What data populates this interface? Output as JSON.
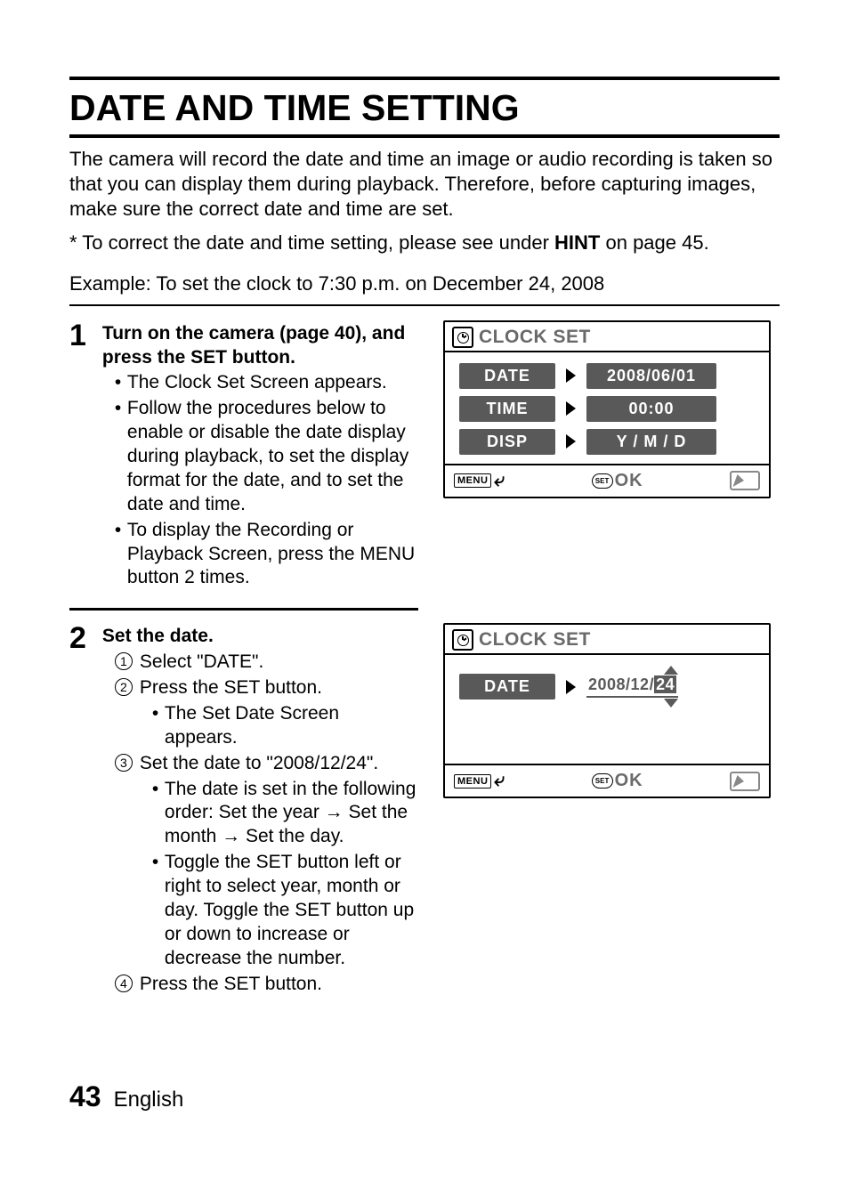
{
  "title": "DATE AND TIME SETTING",
  "intro": {
    "p1": "The camera will record the date and time an image or audio recording is taken so that you can display them during playback. Therefore, before capturing images, make sure the correct date and time are set.",
    "p2_pre": "* To correct the date and time setting, please see under ",
    "p2_hint": "HINT",
    "p2_post": " on page 45."
  },
  "example": "Example: To set the clock to 7:30 p.m. on December 24, 2008",
  "step1": {
    "num": "1",
    "title": "Turn on the camera (page 40), and press the SET button.",
    "b1": "The Clock Set Screen appears.",
    "b2": "Follow the procedures below to enable or disable the date display during playback, to set the display format for the date, and to set the date and time.",
    "b3": "To display the Recording or Playback Screen, press the MENU button 2 times."
  },
  "step2": {
    "num": "2",
    "title": "Set the date.",
    "c1": "Select \"DATE\".",
    "c2": "Press the SET button.",
    "c2s1": "The Set Date Screen appears.",
    "c3": "Set the date to \"2008/12/24\".",
    "c3s1": "The date is set in the following order: Set the year → Set the month → Set the day.",
    "c3s2": "Toggle the SET button left or right to select year, month or day. Toggle the SET button up or down to increase or decrease the number.",
    "c4": "Press the SET button."
  },
  "lcd1": {
    "heading": "CLOCK SET",
    "rows": {
      "date_label": "DATE",
      "date_value": "2008/06/01",
      "time_label": "TIME",
      "time_value": "00:00",
      "disp_label": "DISP",
      "disp_value": "Y / M / D"
    },
    "footer": {
      "menu": "MENU",
      "set": "SET",
      "ok": "OK"
    }
  },
  "lcd2": {
    "heading": "CLOCK SET",
    "date_label": "DATE",
    "date_prefix": "2008/12/",
    "date_active": "24",
    "footer": {
      "menu": "MENU",
      "set": "SET",
      "ok": "OK"
    }
  },
  "footer": {
    "page": "43",
    "language": "English"
  }
}
